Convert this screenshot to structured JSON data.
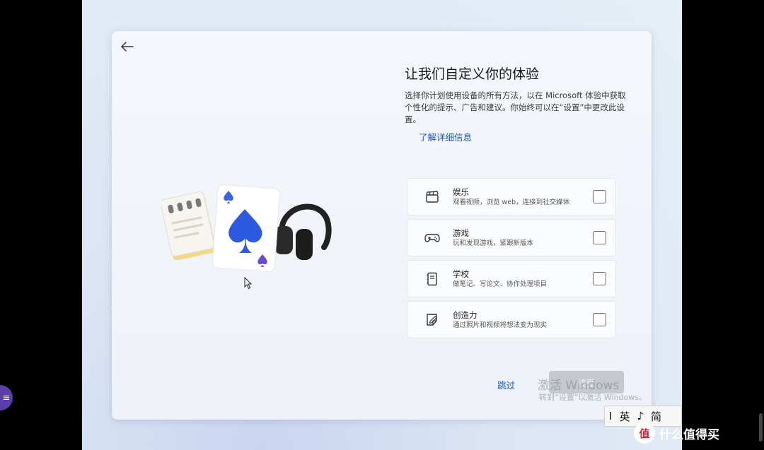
{
  "page": {
    "title": "让我们自定义你的体验",
    "description": "选择你计划使用设备的所有方法，以在 Microsoft 体验中获取个性化的提示、广告和建议。你始终可以在“设置”中更改此设置。",
    "learn_more": "了解详细信息"
  },
  "options": [
    {
      "label": "娱乐",
      "sub": "观看视频，浏览 web，连接到社交媒体",
      "icon": "clapperboard-icon",
      "checked": false
    },
    {
      "label": "游戏",
      "sub": "玩和发现游戏，紧跟新版本",
      "icon": "gamepad-icon",
      "checked": false
    },
    {
      "label": "学校",
      "sub": "做笔记、写论文、协作处理项目",
      "icon": "notebook-icon",
      "checked": false
    },
    {
      "label": "创造力",
      "sub": "通过照片和视频将想法变为现实",
      "icon": "sticky-note-pen-icon",
      "checked": false
    }
  ],
  "footer": {
    "skip_label": "跳过",
    "next_label": "接受"
  },
  "watermark": {
    "line1": "激活 Windows",
    "line2": "转到“设置”以激活 Windows。"
  },
  "ime": {
    "cursor": "I",
    "mode": "英",
    "punct": "♪",
    "script": "简"
  },
  "brand": {
    "badge": "值",
    "text": "什么值得买"
  },
  "colors": {
    "accent": "#1a56b8",
    "dialog_bg": "#f2f5fa",
    "next_button_bg": "#c5c9cf"
  }
}
